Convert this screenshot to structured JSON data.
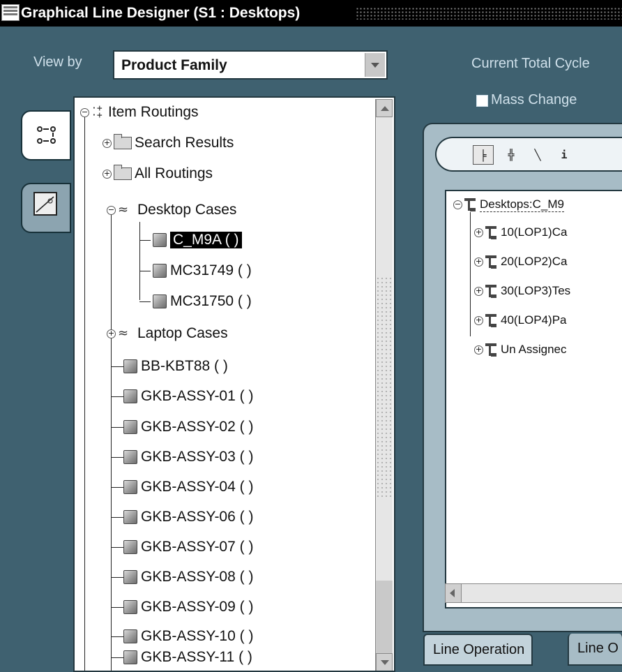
{
  "window": {
    "title": "Graphical Line Designer (S1 : Desktops)"
  },
  "view_by": {
    "label": "View by",
    "value": "Product Family"
  },
  "cycle": {
    "label": "Current Total Cycle"
  },
  "mass_change": {
    "label": "Mass Change",
    "checked": false
  },
  "tree": {
    "root": "Item Routings",
    "search_results": "Search Results",
    "all_routings": "All Routings",
    "desktop_cases": "Desktop Cases",
    "desktop_items": [
      "C_M9A ( )",
      "MC31749 ( )",
      "MC31750 ( )"
    ],
    "laptop_cases": "Laptop Cases",
    "items": [
      "BB-KBT88 ( )",
      "GKB-ASSY-01 ( )",
      "GKB-ASSY-02 ( )",
      "GKB-ASSY-03 ( )",
      "GKB-ASSY-04 ( )",
      "GKB-ASSY-06 ( )",
      "GKB-ASSY-07 ( )",
      "GKB-ASSY-08 ( )",
      "GKB-ASSY-09 ( )",
      "GKB-ASSY-10 ( )",
      "GKB-ASSY-11 ( )"
    ]
  },
  "operations": {
    "root": "Desktops:C_M9",
    "rows": [
      "10(LOP1)Ca",
      "20(LOP2)Ca",
      "30(LOP3)Tes",
      "40(LOP4)Pa",
      "Un Assignec"
    ]
  },
  "bottom_tabs": [
    "Line Operation",
    "Line O"
  ]
}
